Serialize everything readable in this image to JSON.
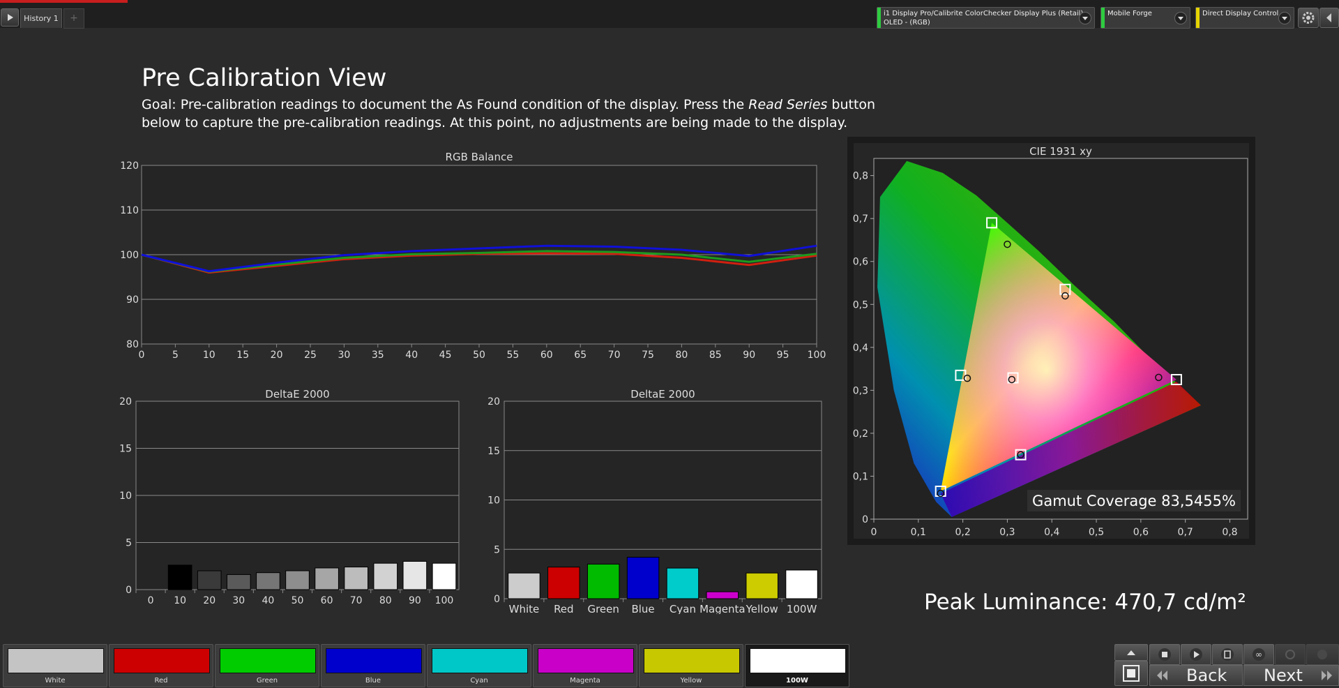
{
  "topbar": {
    "tab_label": "History 1",
    "tab_add": "+",
    "devices": [
      {
        "line1": "i1 Display Pro/Calibrite ColorChecker Display Plus (Retail)",
        "line2": "OLED - (RGB)",
        "color": "#2ecc40"
      },
      {
        "line1": "Mobile Forge",
        "line2": "",
        "color": "#2ecc40"
      },
      {
        "line1": "Direct Display Control",
        "line2": "",
        "color": "#e6d400"
      }
    ]
  },
  "page": {
    "title": "Pre Calibration View",
    "goal_before": "Goal: Pre-calibration readings to document the As Found condition of the display. Press the ",
    "goal_emphasis": "Read Series",
    "goal_after": " button below to capture the pre-calibration readings. At this point, no adjustments are being made to the display.",
    "peak_luminance": "Peak Luminance: 470,7 cd/m²"
  },
  "chart_data": [
    {
      "type": "line",
      "title": "RGB Balance",
      "x": [
        0,
        10,
        20,
        30,
        40,
        50,
        60,
        70,
        80,
        90,
        100
      ],
      "xticks": [
        "0",
        "5",
        "10",
        "15",
        "20",
        "25",
        "30",
        "35",
        "40",
        "45",
        "50",
        "55",
        "60",
        "65",
        "70",
        "75",
        "80",
        "85",
        "90",
        "95",
        "100"
      ],
      "yticks": [
        "80",
        "90",
        "100",
        "110",
        "120"
      ],
      "xlim": [
        0,
        100
      ],
      "ylim": [
        80,
        120
      ],
      "series": [
        {
          "color": "#d02010",
          "values": [
            100,
            96,
            97.5,
            99,
            99.8,
            100.2,
            100.3,
            100.2,
            99.3,
            97.7,
            99.8
          ]
        },
        {
          "color": "#1e9a1e",
          "values": [
            100,
            96.2,
            97.8,
            99.3,
            100.1,
            100.4,
            100.8,
            100.6,
            100,
            98.4,
            100.2
          ]
        },
        {
          "color": "#1010d8",
          "values": [
            100,
            96.3,
            98.2,
            99.9,
            100.8,
            101.4,
            102,
            101.8,
            101.1,
            99.7,
            102
          ]
        }
      ]
    },
    {
      "type": "bar",
      "title": "DeltaE 2000",
      "categories": [
        "0",
        "10",
        "20",
        "30",
        "40",
        "50",
        "60",
        "70",
        "80",
        "90",
        "100"
      ],
      "values": [
        0,
        2.6,
        2.0,
        1.6,
        1.8,
        2.0,
        2.3,
        2.4,
        2.8,
        3.0,
        2.8
      ],
      "colors": [
        "#000000",
        "#000000",
        "#3a3a3a",
        "#5a5a5a",
        "#767676",
        "#8e8e8e",
        "#a6a6a6",
        "#bcbcbc",
        "#d2d2d2",
        "#e6e6e6",
        "#ffffff"
      ],
      "yticks": [
        "0",
        "5",
        "10",
        "15",
        "20"
      ],
      "ylim": [
        0,
        20
      ]
    },
    {
      "type": "bar",
      "title": "DeltaE 2000",
      "categories": [
        "White",
        "Red",
        "Green",
        "Blue",
        "Cyan",
        "Magenta",
        "Yellow",
        "100W"
      ],
      "values": [
        2.6,
        3.2,
        3.5,
        4.2,
        3.1,
        0.7,
        2.6,
        2.9
      ],
      "colors": [
        "#cccccc",
        "#cc0000",
        "#00bb00",
        "#0000cc",
        "#00cccc",
        "#cc00cc",
        "#cccc00",
        "#ffffff"
      ],
      "yticks": [
        "0",
        "5",
        "10",
        "15",
        "20"
      ],
      "ylim": [
        0,
        20
      ]
    },
    {
      "type": "scatter",
      "title": "CIE 1931 xy",
      "xticks": [
        "0",
        "0,1",
        "0,2",
        "0,3",
        "0,4",
        "0,5",
        "0,6",
        "0,7",
        "0,8"
      ],
      "yticks": [
        "0",
        "0,1",
        "0,2",
        "0,3",
        "0,4",
        "0,5",
        "0,6",
        "0,7",
        "0,8"
      ],
      "xlim": [
        0,
        0.84
      ],
      "ylim": [
        0,
        0.84
      ],
      "targets": [
        [
          0.265,
          0.69
        ],
        [
          0.43,
          0.535
        ],
        [
          0.68,
          0.325
        ],
        [
          0.15,
          0.065
        ],
        [
          0.195,
          0.335
        ],
        [
          0.33,
          0.15
        ],
        [
          0.3127,
          0.329
        ]
      ],
      "measured": [
        [
          0.3,
          0.64
        ],
        [
          0.43,
          0.52
        ],
        [
          0.64,
          0.33
        ],
        [
          0.15,
          0.06
        ],
        [
          0.21,
          0.328
        ],
        [
          0.33,
          0.15
        ],
        [
          0.31,
          0.325
        ]
      ],
      "gamut_coverage": "Gamut Coverage 83,5455%"
    }
  ],
  "swatches": [
    {
      "label": "White",
      "color": "#c4c4c4"
    },
    {
      "label": "Red",
      "color": "#cc0000"
    },
    {
      "label": "Green",
      "color": "#00cc00"
    },
    {
      "label": "Blue",
      "color": "#0000cc"
    },
    {
      "label": "Cyan",
      "color": "#00c8c8"
    },
    {
      "label": "Magenta",
      "color": "#c800c8"
    },
    {
      "label": "Yellow",
      "color": "#c8c800"
    },
    {
      "label": "100W",
      "color": "#ffffff"
    }
  ],
  "nav": {
    "back": "Back",
    "next": "Next"
  }
}
